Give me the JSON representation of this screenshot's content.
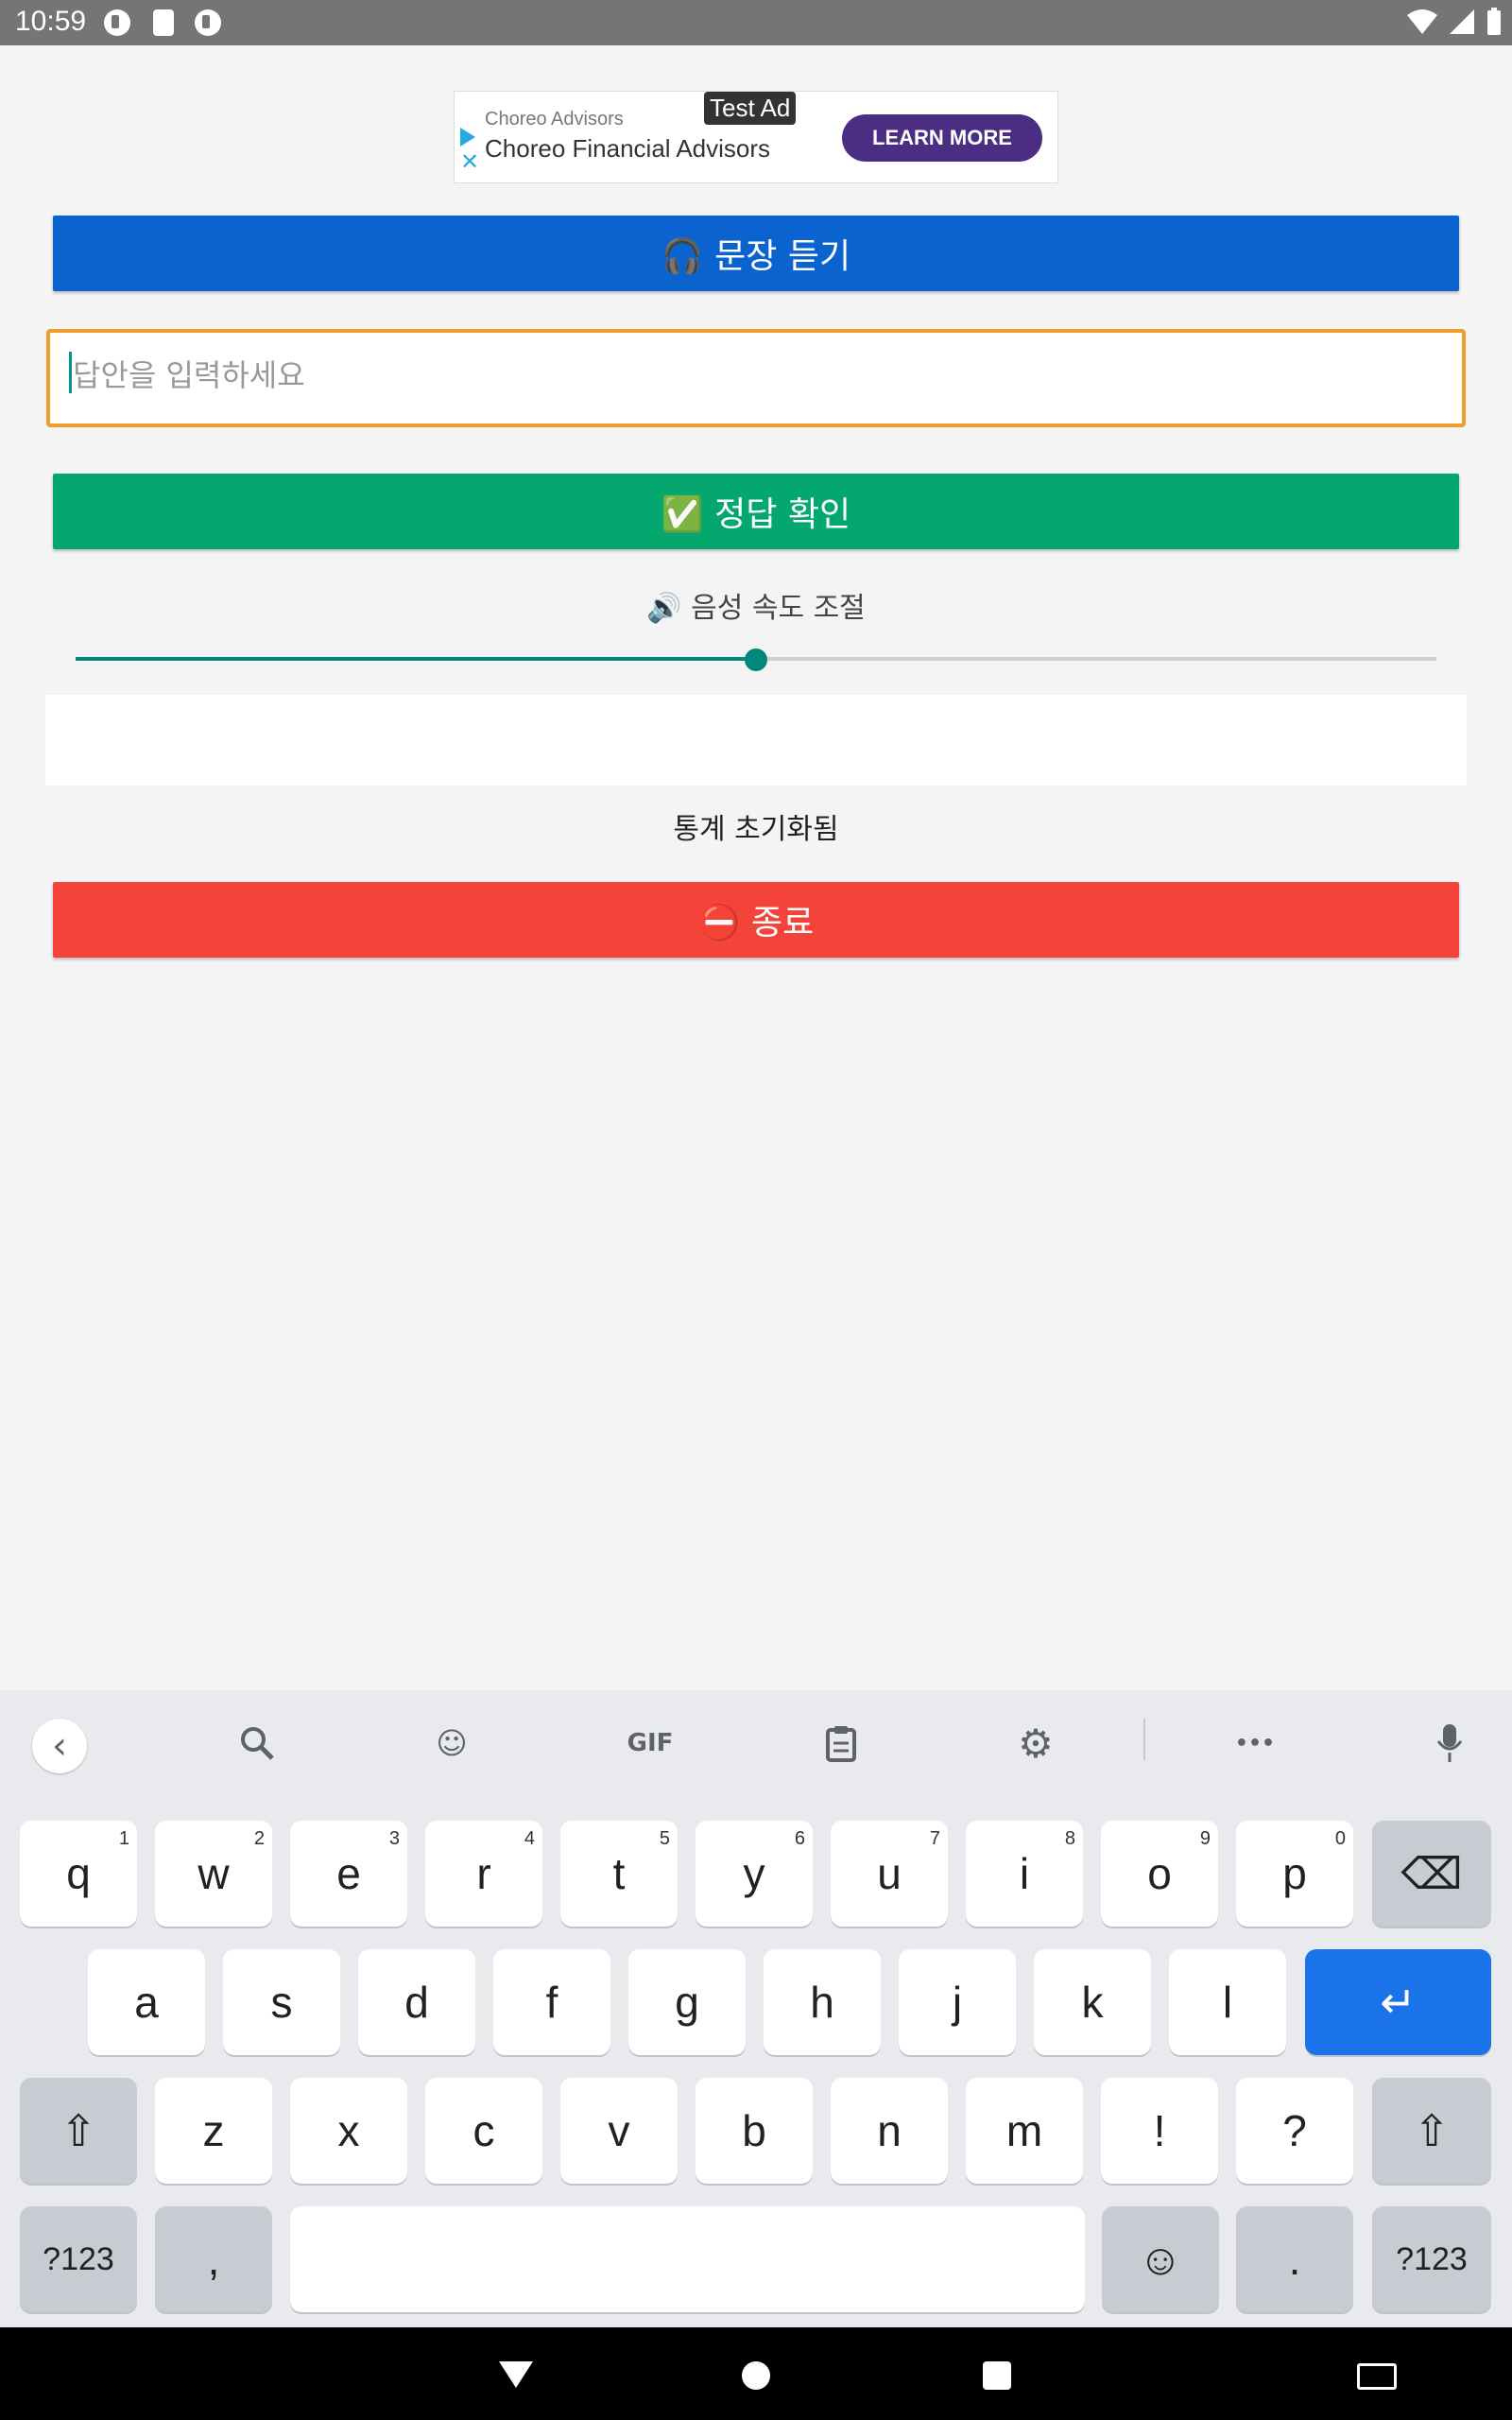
{
  "status_bar": {
    "time": "10:59"
  },
  "ad": {
    "badge": "Test Ad",
    "advertiser": "Choreo Advisors",
    "headline": "Choreo Financial Advisors",
    "cta": "LEARN MORE",
    "close": "✕"
  },
  "main": {
    "listen_button": "🎧 문장 듣기",
    "answer_placeholder": "답안을 입력하세요",
    "check_button": "✅ 정답 확인",
    "speed_label": "🔊 음성 속도 조절",
    "speed_value": 0.5,
    "result_text": "",
    "stats_text": "통계 초기화됨",
    "exit_button": "⛔ 종료"
  },
  "keyboard": {
    "toolbar": {
      "back": "‹",
      "search": "🔍",
      "sticker": "☺",
      "gif": "GIF",
      "clipboard": "📋",
      "settings": "⚙",
      "more": "•••",
      "mic": "🎤"
    },
    "row1": [
      {
        "k": "q",
        "n": "1"
      },
      {
        "k": "w",
        "n": "2"
      },
      {
        "k": "e",
        "n": "3"
      },
      {
        "k": "r",
        "n": "4"
      },
      {
        "k": "t",
        "n": "5"
      },
      {
        "k": "y",
        "n": "6"
      },
      {
        "k": "u",
        "n": "7"
      },
      {
        "k": "i",
        "n": "8"
      },
      {
        "k": "o",
        "n": "9"
      },
      {
        "k": "p",
        "n": "0"
      }
    ],
    "row2": [
      "a",
      "s",
      "d",
      "f",
      "g",
      "h",
      "j",
      "k",
      "l"
    ],
    "row3": [
      "z",
      "x",
      "c",
      "v",
      "b",
      "n",
      "m",
      "!",
      "?"
    ],
    "backspace": "⌫",
    "enter": "↵",
    "shift": "⇧",
    "symbols": "?123",
    "comma": ",",
    "emoji": "☺",
    "period": "."
  },
  "colors": {
    "listen": "#0a63cf",
    "check": "#04a86f",
    "exit": "#f4433b",
    "input_border": "#f29a2e",
    "slider": "#00897b",
    "enter_key": "#1a73e8"
  }
}
